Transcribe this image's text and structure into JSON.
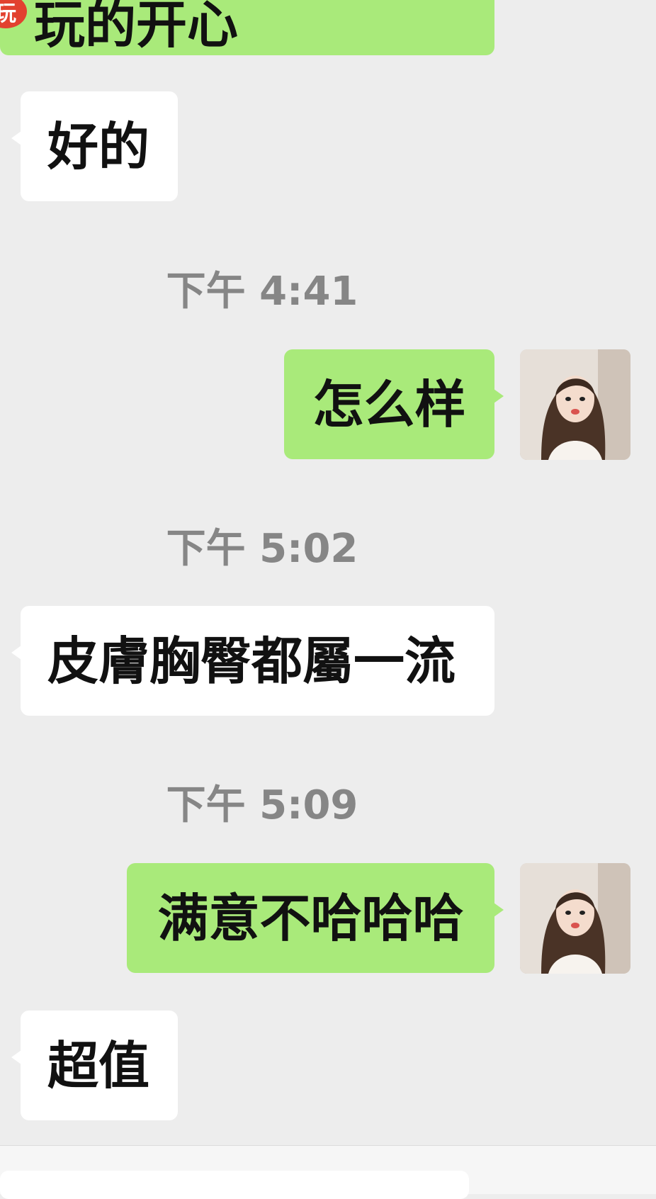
{
  "messages": [
    {
      "side": "out",
      "text": "玩的开心",
      "partial": true
    },
    {
      "side": "in",
      "text": "好的"
    },
    {
      "type": "time",
      "text": "下午 4:41"
    },
    {
      "side": "out",
      "text": "怎么样"
    },
    {
      "type": "time",
      "text": "下午 5:02"
    },
    {
      "side": "in",
      "text": "皮膚胸臀都屬一流"
    },
    {
      "type": "time",
      "text": "下午 5:09"
    },
    {
      "side": "out",
      "text": "满意不哈哈哈"
    },
    {
      "side": "in",
      "text": "超值"
    }
  ],
  "reaction_badge": "玩",
  "input": {
    "placeholder": ""
  }
}
